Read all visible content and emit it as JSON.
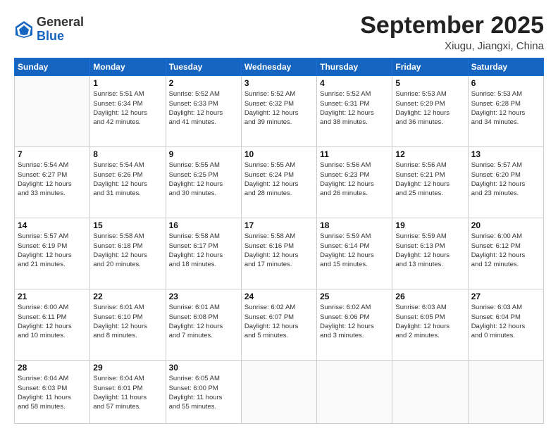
{
  "header": {
    "logo_general": "General",
    "logo_blue": "Blue",
    "month_title": "September 2025",
    "location": "Xiugu, Jiangxi, China"
  },
  "weekdays": [
    "Sunday",
    "Monday",
    "Tuesday",
    "Wednesday",
    "Thursday",
    "Friday",
    "Saturday"
  ],
  "weeks": [
    [
      {
        "day": "",
        "info": ""
      },
      {
        "day": "1",
        "info": "Sunrise: 5:51 AM\nSunset: 6:34 PM\nDaylight: 12 hours\nand 42 minutes."
      },
      {
        "day": "2",
        "info": "Sunrise: 5:52 AM\nSunset: 6:33 PM\nDaylight: 12 hours\nand 41 minutes."
      },
      {
        "day": "3",
        "info": "Sunrise: 5:52 AM\nSunset: 6:32 PM\nDaylight: 12 hours\nand 39 minutes."
      },
      {
        "day": "4",
        "info": "Sunrise: 5:52 AM\nSunset: 6:31 PM\nDaylight: 12 hours\nand 38 minutes."
      },
      {
        "day": "5",
        "info": "Sunrise: 5:53 AM\nSunset: 6:29 PM\nDaylight: 12 hours\nand 36 minutes."
      },
      {
        "day": "6",
        "info": "Sunrise: 5:53 AM\nSunset: 6:28 PM\nDaylight: 12 hours\nand 34 minutes."
      }
    ],
    [
      {
        "day": "7",
        "info": "Sunrise: 5:54 AM\nSunset: 6:27 PM\nDaylight: 12 hours\nand 33 minutes."
      },
      {
        "day": "8",
        "info": "Sunrise: 5:54 AM\nSunset: 6:26 PM\nDaylight: 12 hours\nand 31 minutes."
      },
      {
        "day": "9",
        "info": "Sunrise: 5:55 AM\nSunset: 6:25 PM\nDaylight: 12 hours\nand 30 minutes."
      },
      {
        "day": "10",
        "info": "Sunrise: 5:55 AM\nSunset: 6:24 PM\nDaylight: 12 hours\nand 28 minutes."
      },
      {
        "day": "11",
        "info": "Sunrise: 5:56 AM\nSunset: 6:23 PM\nDaylight: 12 hours\nand 26 minutes."
      },
      {
        "day": "12",
        "info": "Sunrise: 5:56 AM\nSunset: 6:21 PM\nDaylight: 12 hours\nand 25 minutes."
      },
      {
        "day": "13",
        "info": "Sunrise: 5:57 AM\nSunset: 6:20 PM\nDaylight: 12 hours\nand 23 minutes."
      }
    ],
    [
      {
        "day": "14",
        "info": "Sunrise: 5:57 AM\nSunset: 6:19 PM\nDaylight: 12 hours\nand 21 minutes."
      },
      {
        "day": "15",
        "info": "Sunrise: 5:58 AM\nSunset: 6:18 PM\nDaylight: 12 hours\nand 20 minutes."
      },
      {
        "day": "16",
        "info": "Sunrise: 5:58 AM\nSunset: 6:17 PM\nDaylight: 12 hours\nand 18 minutes."
      },
      {
        "day": "17",
        "info": "Sunrise: 5:58 AM\nSunset: 6:16 PM\nDaylight: 12 hours\nand 17 minutes."
      },
      {
        "day": "18",
        "info": "Sunrise: 5:59 AM\nSunset: 6:14 PM\nDaylight: 12 hours\nand 15 minutes."
      },
      {
        "day": "19",
        "info": "Sunrise: 5:59 AM\nSunset: 6:13 PM\nDaylight: 12 hours\nand 13 minutes."
      },
      {
        "day": "20",
        "info": "Sunrise: 6:00 AM\nSunset: 6:12 PM\nDaylight: 12 hours\nand 12 minutes."
      }
    ],
    [
      {
        "day": "21",
        "info": "Sunrise: 6:00 AM\nSunset: 6:11 PM\nDaylight: 12 hours\nand 10 minutes."
      },
      {
        "day": "22",
        "info": "Sunrise: 6:01 AM\nSunset: 6:10 PM\nDaylight: 12 hours\nand 8 minutes."
      },
      {
        "day": "23",
        "info": "Sunrise: 6:01 AM\nSunset: 6:08 PM\nDaylight: 12 hours\nand 7 minutes."
      },
      {
        "day": "24",
        "info": "Sunrise: 6:02 AM\nSunset: 6:07 PM\nDaylight: 12 hours\nand 5 minutes."
      },
      {
        "day": "25",
        "info": "Sunrise: 6:02 AM\nSunset: 6:06 PM\nDaylight: 12 hours\nand 3 minutes."
      },
      {
        "day": "26",
        "info": "Sunrise: 6:03 AM\nSunset: 6:05 PM\nDaylight: 12 hours\nand 2 minutes."
      },
      {
        "day": "27",
        "info": "Sunrise: 6:03 AM\nSunset: 6:04 PM\nDaylight: 12 hours\nand 0 minutes."
      }
    ],
    [
      {
        "day": "28",
        "info": "Sunrise: 6:04 AM\nSunset: 6:03 PM\nDaylight: 11 hours\nand 58 minutes."
      },
      {
        "day": "29",
        "info": "Sunrise: 6:04 AM\nSunset: 6:01 PM\nDaylight: 11 hours\nand 57 minutes."
      },
      {
        "day": "30",
        "info": "Sunrise: 6:05 AM\nSunset: 6:00 PM\nDaylight: 11 hours\nand 55 minutes."
      },
      {
        "day": "",
        "info": ""
      },
      {
        "day": "",
        "info": ""
      },
      {
        "day": "",
        "info": ""
      },
      {
        "day": "",
        "info": ""
      }
    ]
  ]
}
